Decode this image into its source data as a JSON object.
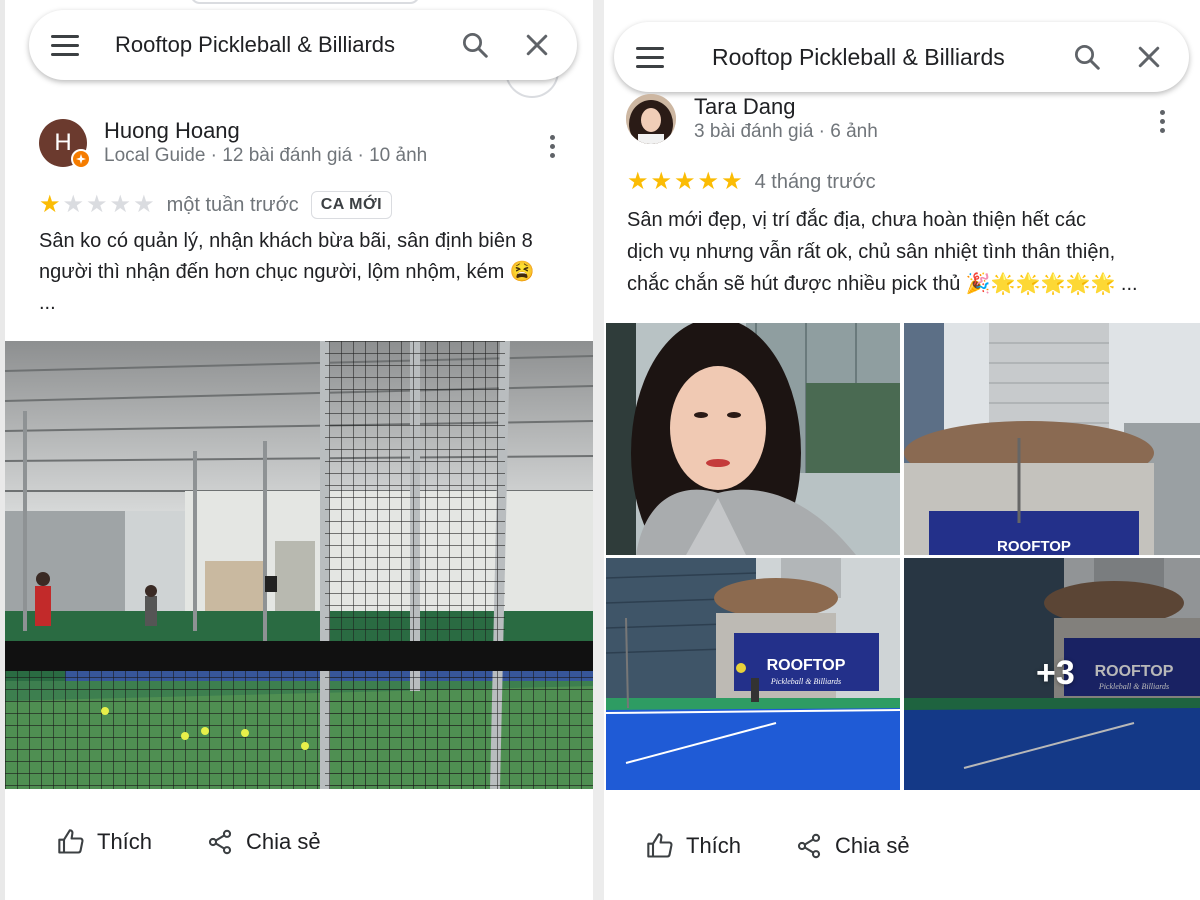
{
  "left": {
    "search": {
      "title": "Rooftop Pickleball & Billiards"
    },
    "review": {
      "avatar_letter": "H",
      "name": "Huong Hoang",
      "meta": "Local Guide · 12 bài đánh giá · 10 ảnh",
      "rating": 1,
      "time": "một tuần trước",
      "badge": "CA MỚI",
      "text_line1": "Sân ko có quản lý, nhận khách bừa bãi, sân định biên 8",
      "text_line2": "người thì nhận đến hơn chục người, lộm nhộm, kém 😫",
      "text_line3": "..."
    },
    "actions": {
      "like": "Thích",
      "share": "Chia sẻ"
    }
  },
  "right": {
    "search": {
      "title": "Rooftop Pickleball & Billiards"
    },
    "review": {
      "name": "Tara Dang",
      "meta": "3 bài đánh giá · 6 ảnh",
      "rating": 5,
      "time": "4 tháng trước",
      "text_line1": "Sân mới đẹp, vị trí đắc địa, chưa hoàn thiện hết các",
      "text_line2": "dịch vụ nhưng vẫn rất ok, chủ sân nhiệt tình thân thiện,",
      "text_line3": "chắc chắn sẽ hút được nhiều pick thủ 🎉🌟🌟🌟🌟🌟 ..."
    },
    "photos": {
      "more_count": "+3",
      "sign_text": "ROOFTOP",
      "sign_sub": "Pickleball & Billiards"
    },
    "actions": {
      "like": "Thích",
      "share": "Chia sẻ"
    }
  },
  "colors": {
    "star": "#fbbc04",
    "star_off": "#dadce0",
    "court_blue": "#1f5bd6",
    "court_green": "#2e9c63",
    "sign_navy": "#23308a",
    "guide_orange": "#f57c00"
  },
  "icons": [
    "menu-icon",
    "search-icon",
    "close-icon",
    "more-vert-icon",
    "thumb-up-icon",
    "share-icon",
    "local-guide-icon"
  ]
}
